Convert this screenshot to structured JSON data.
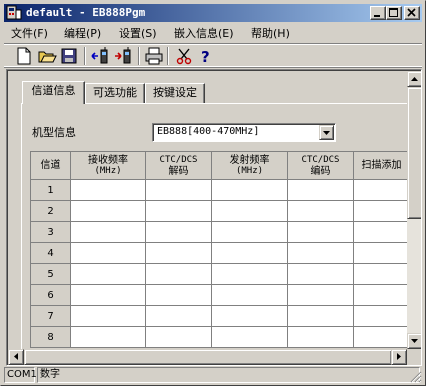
{
  "window": {
    "title": "default - EB888Pgm"
  },
  "menu": [
    {
      "label": "文件(F)"
    },
    {
      "label": "编程(P)"
    },
    {
      "label": "设置(S)"
    },
    {
      "label": "嵌入信息(E)"
    },
    {
      "label": "帮助(H)"
    }
  ],
  "toolbar": {
    "icons": [
      "new-file-icon",
      "open-folder-icon",
      "save-disk-icon",
      "read-radio-icon",
      "write-radio-icon",
      "print-icon",
      "cut-icon",
      "help-icon"
    ]
  },
  "tabs": [
    {
      "label": "信道信息",
      "active": true
    },
    {
      "label": "可选功能",
      "active": false
    },
    {
      "label": "按键设定",
      "active": false
    }
  ],
  "model": {
    "label": "机型信息",
    "selected": "EB888[400-470MHz]"
  },
  "table": {
    "columns": [
      {
        "line1": "信道",
        "line2": ""
      },
      {
        "line1": "接收频率",
        "line2": "(MHz)"
      },
      {
        "line1": "CTC/DCS",
        "line2": "解码"
      },
      {
        "line1": "发射频率",
        "line2": "(MHz)"
      },
      {
        "line1": "CTC/DCS",
        "line2": "编码"
      },
      {
        "line1": "扫描添加",
        "line2": ""
      }
    ],
    "rows": [
      "1",
      "2",
      "3",
      "4",
      "5",
      "6",
      "7",
      "8"
    ]
  },
  "status": {
    "port": "COM1",
    "mode": "数字"
  },
  "colors": {
    "titlebar_start": "#0a246a",
    "titlebar_end": "#a6caf0",
    "face": "#d4d0c8"
  }
}
